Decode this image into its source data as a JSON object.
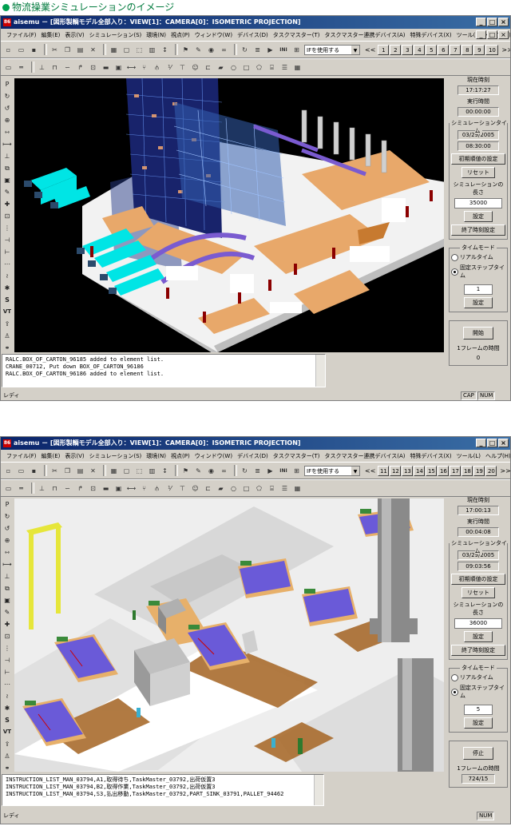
{
  "page_heading": "物流操業シミュレーションのイメージ",
  "menu": [
    "ファイル(F)",
    "編集(E)",
    "表示(V)",
    "シミュレーション(S)",
    "環境(N)",
    "視点(P)",
    "ウィンドウ(W)",
    "デバイス(D)",
    "タスクマスター(T)",
    "タスクマスター連携デバイス(A)",
    "特殊デバイス(X)",
    "ツール(L)",
    "ヘルプ(H)"
  ],
  "window_buttons": {
    "minimize": "_",
    "maximize": "□",
    "close": "×"
  },
  "toolbar": {
    "if_combo": "IFを使用する",
    "prev": "<<",
    "next": ">>",
    "rotate_icon": "↻",
    "ini": "INI"
  },
  "panel_labels": {
    "current_time": "現在時刻",
    "elapsed": "実行時間",
    "sim_time": "シミュレーションタイム",
    "init_time": "初期順値の設定",
    "reset": "リセット",
    "sim_length": "シミュレーションの長さ",
    "set": "設定",
    "end_time_set": "終了時刻設定",
    "time_mode": "タイムモード",
    "realtime": "リアルタイム",
    "fixed_step": "固定ステップタイム",
    "frame_time": "1フレームの時間"
  },
  "screens": [
    {
      "title": "aisemu － [図形製輌モデル全部入り：VIEW[1]：CAMERA[0]：ISOMETRIC PROJECTION]",
      "view_buttons": [
        "1",
        "2",
        "3",
        "4",
        "5",
        "6",
        "7",
        "8",
        "9",
        "10"
      ],
      "current_time": "17:17:27",
      "elapsed": "00:00:00",
      "sim_date": "03/29/2005",
      "sim_clock": "08:30:00",
      "sim_length": "35000",
      "step": "1",
      "run_button": "開始",
      "frame_time": "0",
      "log": [
        "RALC.BOX_OF_CARTON_96185 added to element list.",
        "CRANE_00712, Put down BOX_OF_CARTON_96186",
        "RALC.BOX_OF_CARTON_96186 added to element list."
      ],
      "status_left": "レディ",
      "status_cells": [
        "CAP",
        "NUM"
      ]
    },
    {
      "title": "aisemu － [図形製輌モデル全部入り：VIEW[1]：CAMERA[0]：ISOMETRIC PROJECTION]",
      "view_buttons": [
        "11",
        "12",
        "13",
        "14",
        "15",
        "16",
        "17",
        "18",
        "19",
        "20"
      ],
      "current_time": "17:00:13",
      "elapsed": "00:04:08",
      "sim_date": "03/29/2005",
      "sim_clock": "09:03:56",
      "sim_length": "36000",
      "step": "5",
      "run_button": "停止",
      "frame_time": "724/15",
      "log": [
        "INSTRUCTION_LIST_MAN_03794,A1,取得待ち,TaskMaster_03792,出荷仮置3",
        "INSTRUCTION_LIST_MAN_03794,B2,取得作業,TaskMaster_03792,出荷仮置3",
        "INSTRUCTION_LIST_MAN_03794,S3,払出移動,TaskMaster_03792,PART_SINK_03791,PALLET_94462"
      ],
      "status_left": "レディ",
      "status_cells": [
        "NUM"
      ]
    }
  ]
}
